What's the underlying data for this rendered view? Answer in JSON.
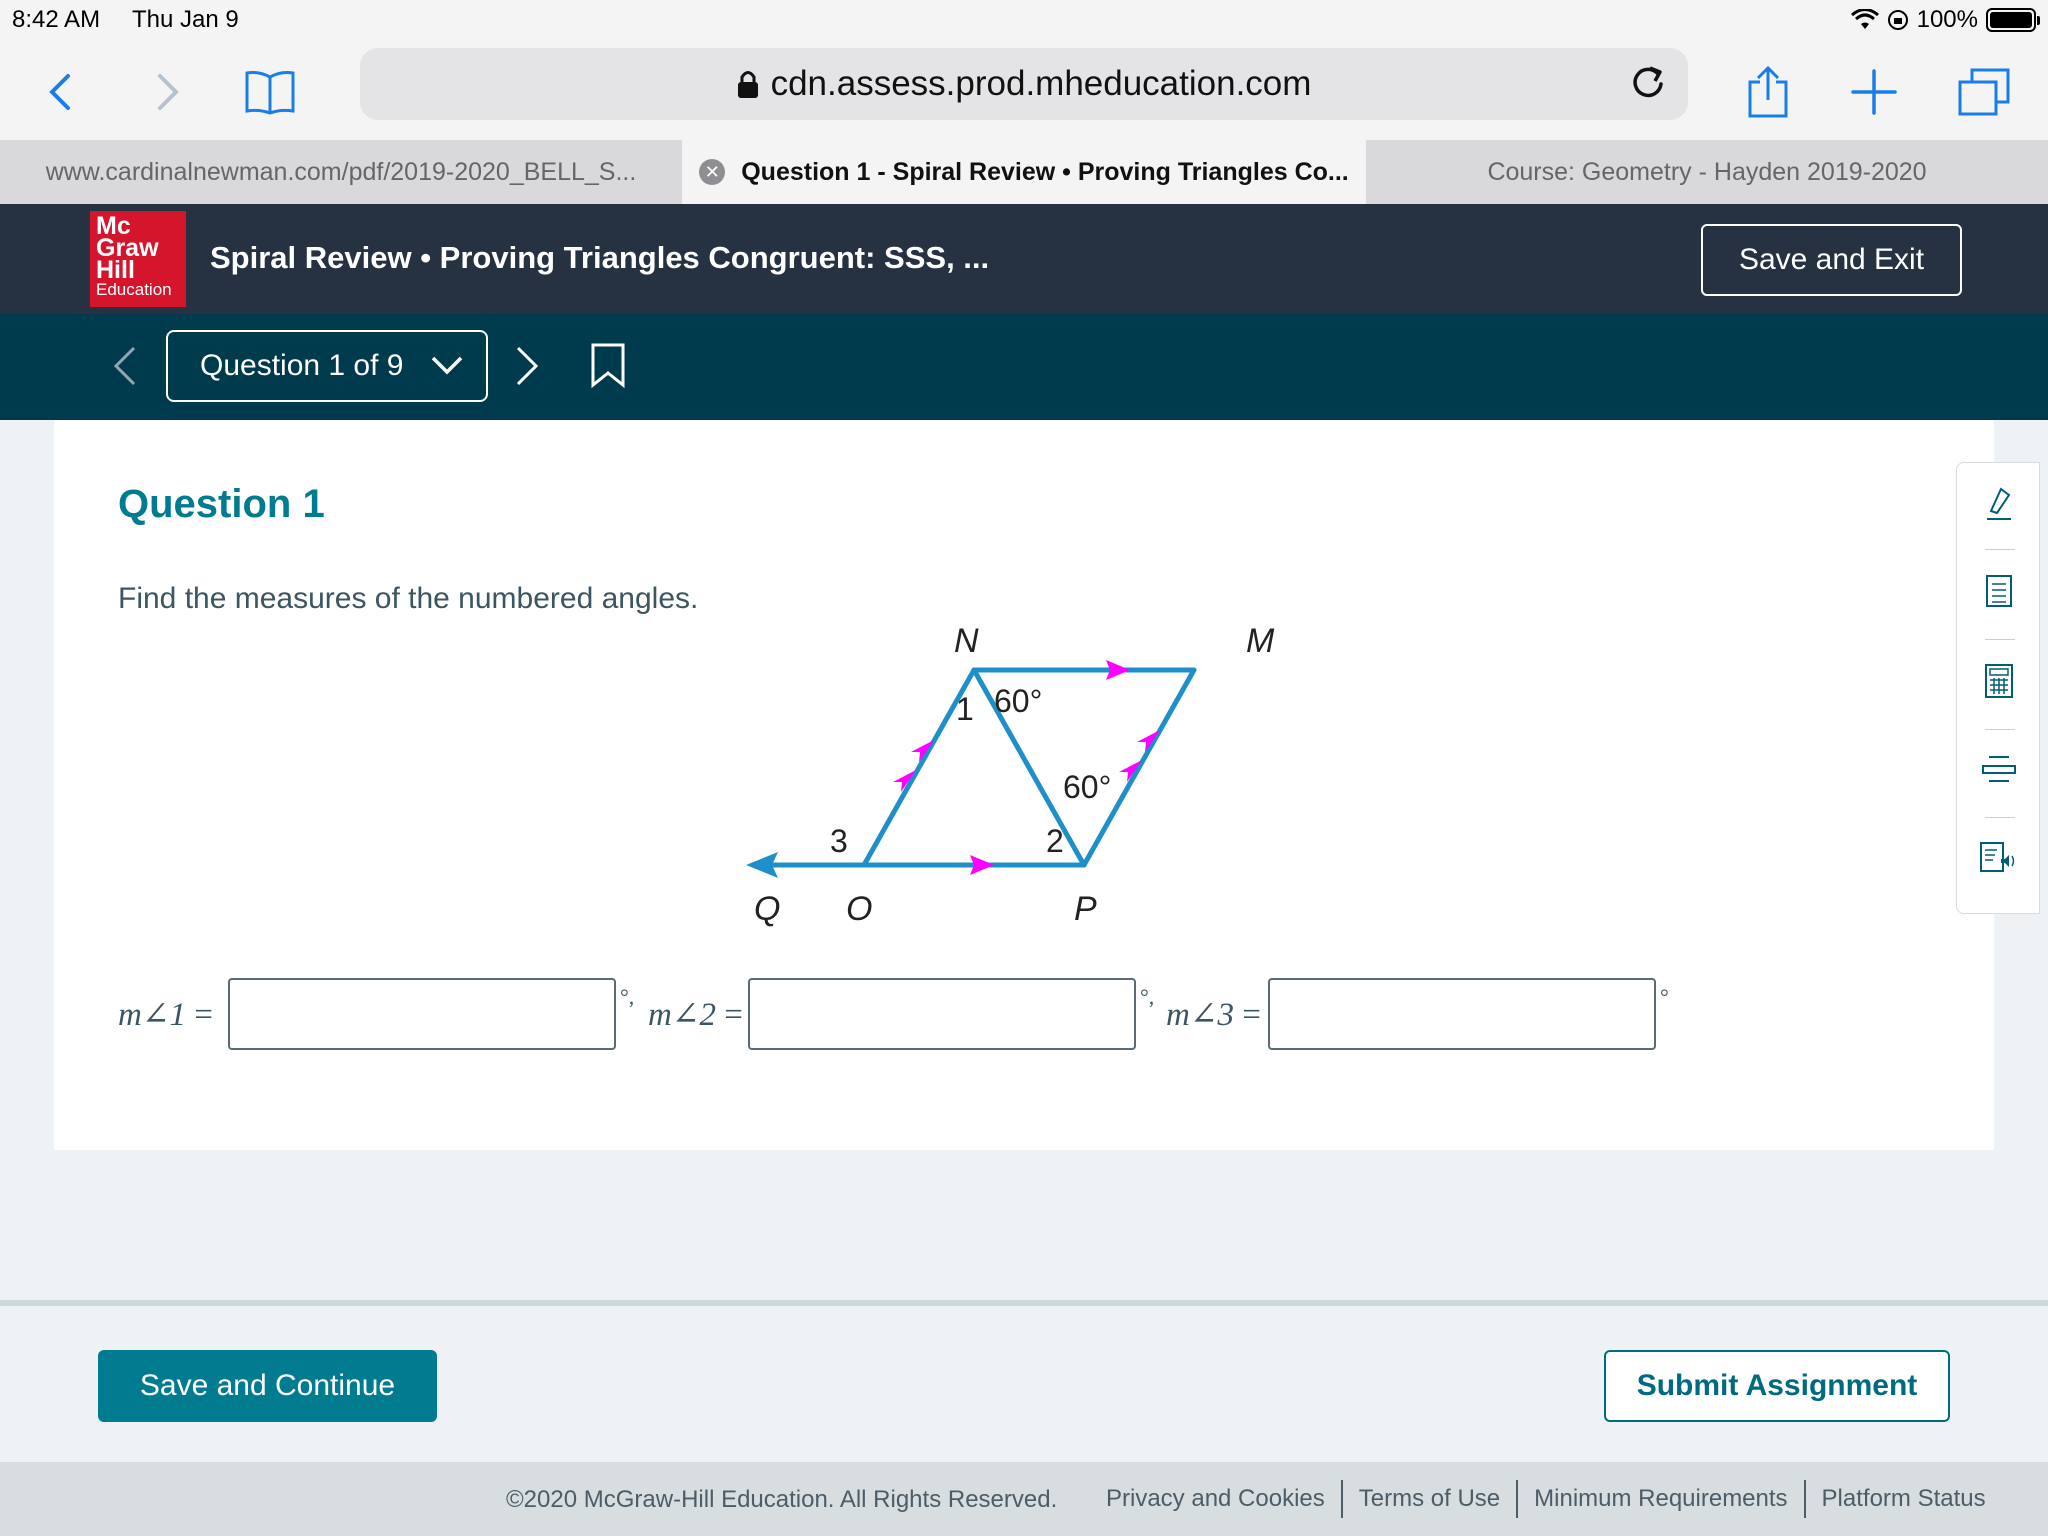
{
  "status_bar": {
    "time": "8:42 AM",
    "date": "Thu Jan 9",
    "battery": "100%"
  },
  "browser": {
    "url": "cdn.assess.prod.mheducation.com",
    "tabs": [
      {
        "label": "www.cardinalnewman.com/pdf/2019-2020_BELL_S...",
        "active": false
      },
      {
        "label": "Question 1 - Spiral Review • Proving Triangles Co...",
        "active": true
      },
      {
        "label": "Course: Geometry - Hayden 2019-2020",
        "active": false
      }
    ]
  },
  "app": {
    "logo": {
      "line1": "Mc",
      "line2": "Graw",
      "line3": "Hill",
      "line4": "Education"
    },
    "title": "Spiral Review • Proving Triangles Congruent: SSS, ...",
    "save_exit": "Save and Exit",
    "question_selector": "Question 1 of 9"
  },
  "question": {
    "title": "Question 1",
    "prompt": "Find the measures of the numbered angles.",
    "diagram": {
      "points": {
        "N": "N",
        "M": "M",
        "Q": "Q",
        "O": "O",
        "P": "P"
      },
      "angle_labels": {
        "a1": "1",
        "a2": "2",
        "a3": "3",
        "top": "60°",
        "mid": "60°"
      }
    },
    "answers": [
      {
        "label": "m∠1",
        "eq": "=",
        "value": "",
        "suffix": "°,"
      },
      {
        "label": "m∠2",
        "eq": "=",
        "value": "",
        "suffix": "°,"
      },
      {
        "label": "m∠3",
        "eq": "=",
        "value": "",
        "suffix": "°"
      }
    ]
  },
  "actions": {
    "save_continue": "Save and Continue",
    "submit": "Submit Assignment"
  },
  "footer": {
    "copyright": "©2020 McGraw-Hill Education. All Rights Reserved.",
    "links": [
      "Privacy and Cookies",
      "Terms of Use",
      "Minimum Requirements",
      "Platform Status"
    ]
  },
  "colors": {
    "header": "#263142",
    "nav": "#003b4d",
    "accent": "#007b8f",
    "logo_red": "#d5152c",
    "arrow_marks": "#ff00ff",
    "lines": "#1f8fc9"
  }
}
